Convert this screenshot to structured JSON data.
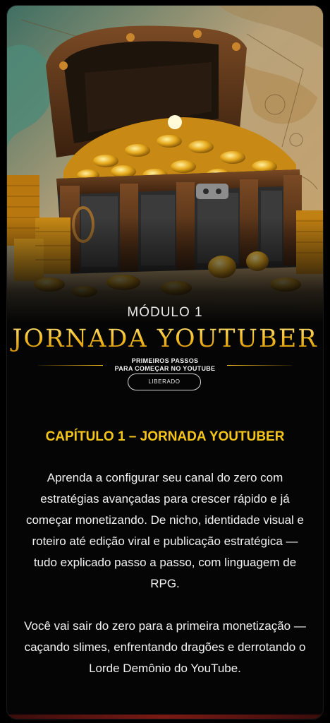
{
  "module": {
    "label": "MÓDULO 1",
    "title": "JORNADA YOUTUBER",
    "subtitle_line1": "PRIMEIROS PASSOS",
    "subtitle_line2": "PARA COMEÇAR NO YOUTUBE",
    "status": "LIBERADO"
  },
  "chapter": {
    "title": "CAPÍTULO 1 – JORNADA YOUTUBER",
    "paragraph1": "Aprenda a configurar seu canal do zero com estratégias avançadas para crescer rápido e já começar monetizando. De nicho, identidade visual e roteiro até edição viral e publicação estratégica — tudo explicado passo a passo, com linguagem de RPG.",
    "paragraph2": "Você vai sair do zero para a primeira monetização — caçando slimes, enfrentando dragões e derrotando o Lorde Demônio do YouTube."
  },
  "colors": {
    "background": "#000000",
    "accent_gold": "#f5c518",
    "text": "#f2f2f2",
    "bottom_bar": "#7a1a14"
  },
  "cover_image": {
    "subject": "treasure-chest-with-gold-coins-over-map"
  }
}
